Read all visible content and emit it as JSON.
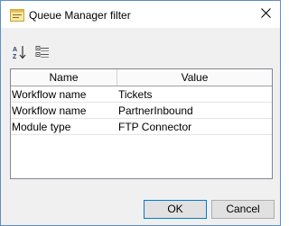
{
  "window": {
    "title": "Queue Manager filter",
    "icon": "window-icon",
    "close_icon": "close-icon"
  },
  "toolbar": {
    "sort_icon": "sort-az-icon",
    "categorize_icon": "categorize-icon"
  },
  "grid": {
    "columns": [
      "Name",
      "Value"
    ],
    "rows": [
      {
        "name": "Workflow name",
        "value": "Tickets"
      },
      {
        "name": "Workflow name",
        "value": "PartnerInbound"
      },
      {
        "name": "Module type",
        "value": "FTP Connector"
      }
    ]
  },
  "buttons": {
    "ok": "OK",
    "cancel": "Cancel"
  },
  "colors": {
    "accent": "#0078d7",
    "window_border": "#5f8ec2",
    "dialog_bg": "#f0f0f0"
  }
}
